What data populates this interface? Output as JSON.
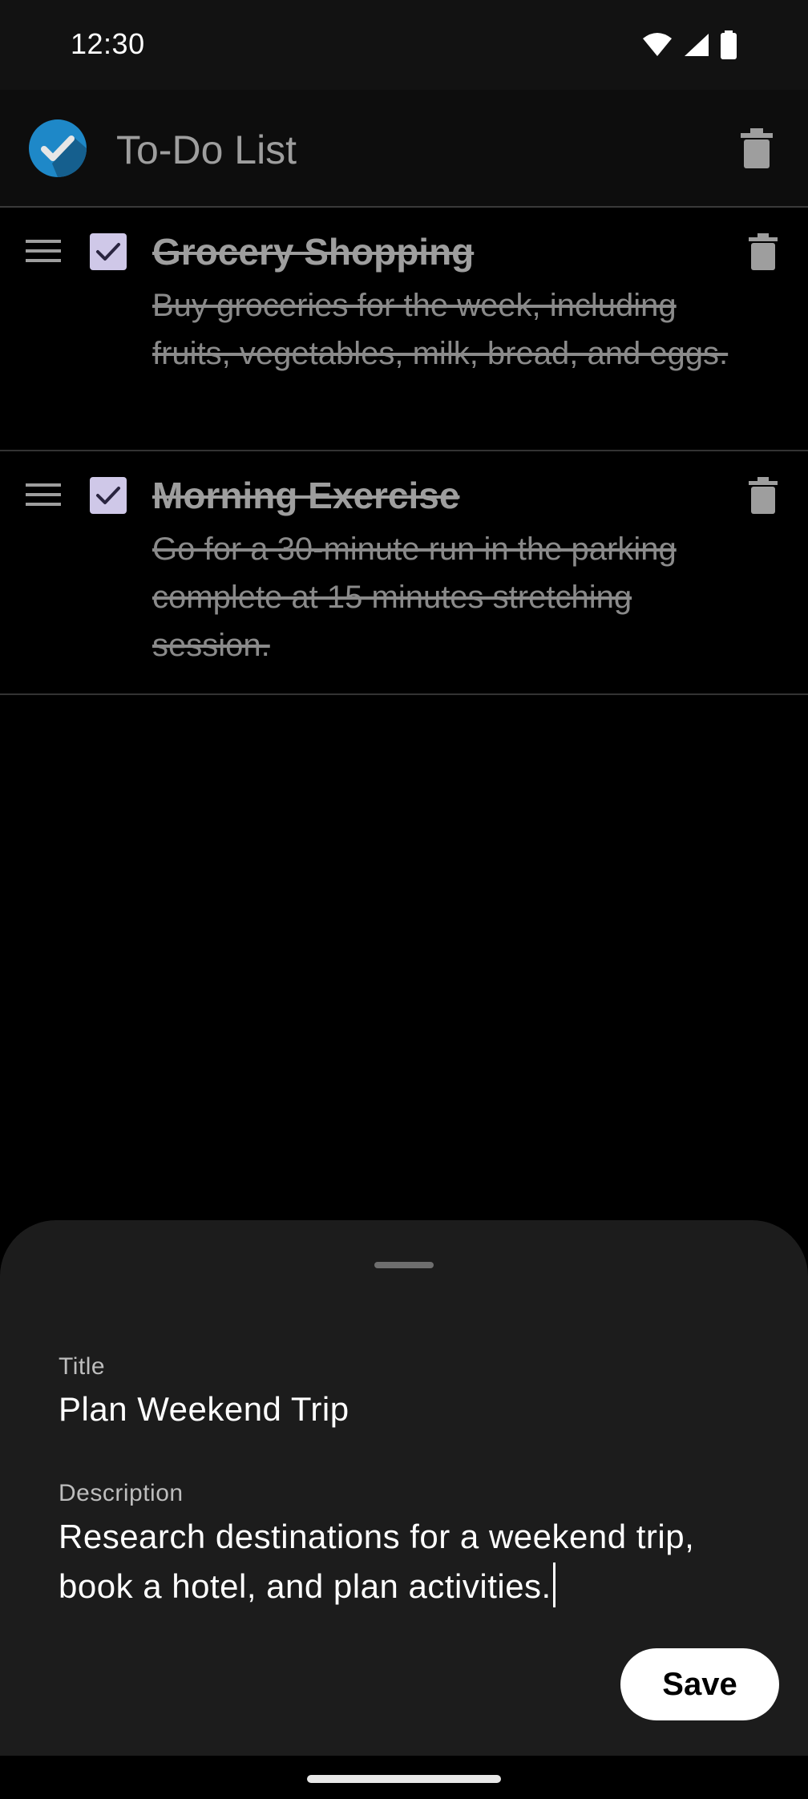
{
  "status_bar": {
    "time": "12:30",
    "icons": [
      "wifi-icon",
      "signal-icon",
      "battery-icon"
    ]
  },
  "app_bar": {
    "title": "To-Do List",
    "logo_icon": "check-circle-icon",
    "delete_icon": "trash-icon"
  },
  "tasks": [
    {
      "title": "Grocery Shopping",
      "description": "Buy groceries for the week, including fruits, vegetables, milk, bread, and eggs.",
      "completed": true
    },
    {
      "title": "Morning Exercise",
      "description": "Go for a 30-minute run in the parking complete at 15 minutes stretching session.",
      "completed": true
    }
  ],
  "sheet": {
    "title_label": "Title",
    "title_value": "Plan Weekend Trip",
    "description_label": "Description",
    "description_value": "Research destinations for a weekend trip, book a hotel, and plan activities.",
    "save_label": "Save"
  },
  "colors": {
    "accent_logo": "#1e88c8",
    "checkbox": "#cfc8e8",
    "sheet_bg": "#1c1c1c"
  }
}
